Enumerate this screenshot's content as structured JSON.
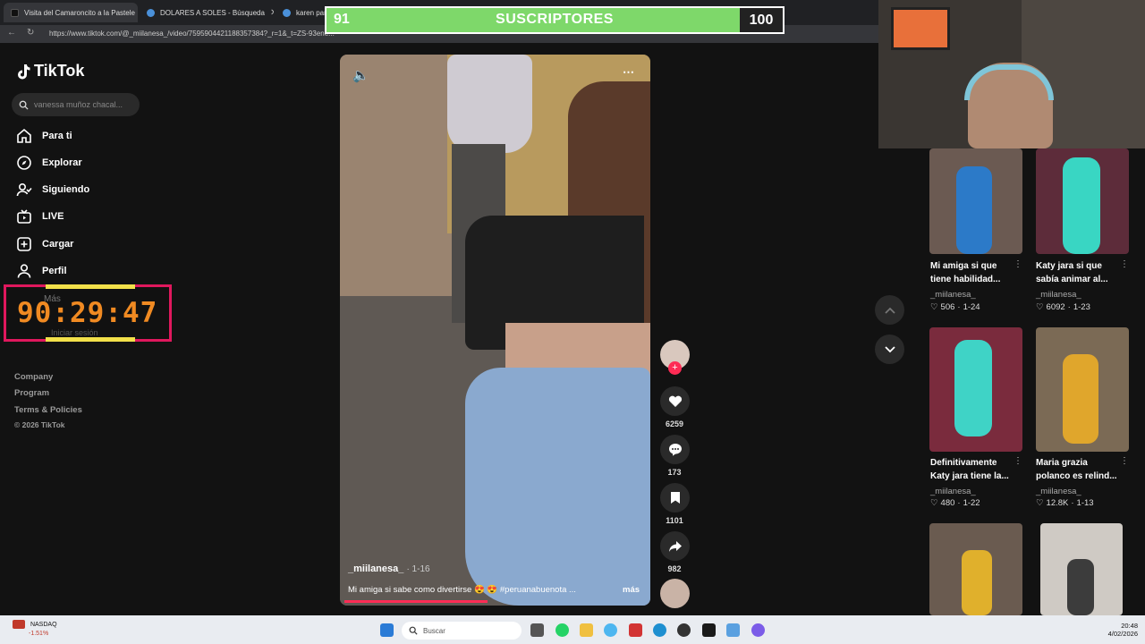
{
  "browser": {
    "tabs": [
      {
        "label": "Visita del Camaroncito a la Pastele"
      },
      {
        "label": "DOLARES A SOLES - Búsqueda"
      },
      {
        "label": "karen pania"
      }
    ],
    "url": "https://www.tiktok.com/@_miilanesa_/video/7595904421188357384?_r=1&_t=ZS-93ene..."
  },
  "sub_counter": {
    "current": "91",
    "label": "SUSCRIPTORES",
    "goal": "100",
    "progress": 0.91
  },
  "tiktok": {
    "logo": "TikTok",
    "search_placeholder": "vanessa muñoz chacal...",
    "nav": [
      {
        "label": "Para ti",
        "icon": "home-icon"
      },
      {
        "label": "Explorar",
        "icon": "compass-icon"
      },
      {
        "label": "Siguiendo",
        "icon": "following-icon"
      },
      {
        "label": "LIVE",
        "icon": "live-icon"
      },
      {
        "label": "Cargar",
        "icon": "upload-icon"
      },
      {
        "label": "Perfil",
        "icon": "profile-icon"
      }
    ],
    "more_label": "Más",
    "login_label": "Iniciar sesión",
    "footer": [
      "Company",
      "Program",
      "Terms & Policies",
      "© 2026 TikTok"
    ]
  },
  "timer": "90:29:47",
  "video": {
    "user": "_miilanesa_",
    "date": "· 1-16",
    "caption": "Mi amiga si sabe como divertirse 😍 😍 #peruanabuenota ...",
    "more": "más",
    "likes": "6259",
    "comments": "173",
    "saves": "1101",
    "shares": "982"
  },
  "related": [
    {
      "title": "Mi amiga si que tiene habilidad...",
      "user": "_miilanesa_",
      "likes": "506",
      "date": "1-24"
    },
    {
      "title": "Katy jara si que sabía animar al...",
      "user": "_miilanesa_",
      "likes": "6092",
      "date": "1-23"
    },
    {
      "title": "Definitivamente Katy jara tiene la...",
      "user": "_miilanesa_",
      "likes": "480",
      "date": "1-22"
    },
    {
      "title": "Maria grazia polanco es relind...",
      "user": "_miilanesa_",
      "likes": "12.8K",
      "date": "1-13"
    }
  ],
  "taskbar": {
    "ticker": "NASDAQ",
    "ticker_change": "-1.51%",
    "search": "Buscar",
    "time": "20:48",
    "date": "4/02/2026"
  }
}
